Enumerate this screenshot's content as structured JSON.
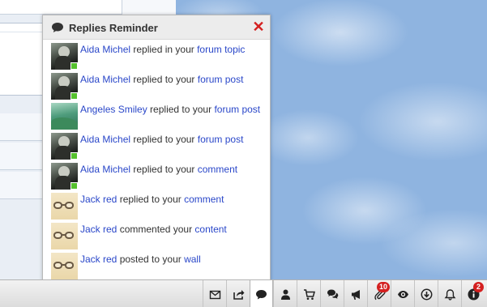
{
  "popup": {
    "title": "Replies Reminder",
    "close_label": "✕",
    "items": [
      {
        "user": "Aida Michel",
        "action": " replied in your ",
        "target": "forum topic",
        "avatar": "dark-portrait",
        "online": true
      },
      {
        "user": "Aida Michel",
        "action": " replied to your ",
        "target": "forum post",
        "avatar": "dark-portrait",
        "online": true
      },
      {
        "user": "Angeles Smiley",
        "action": " replied to your ",
        "target": "forum post",
        "avatar": "green-landscape",
        "online": false
      },
      {
        "user": "Aida Michel",
        "action": " replied to your ",
        "target": "forum post",
        "avatar": "dark-portrait",
        "online": true
      },
      {
        "user": "Aida Michel",
        "action": " replied to your ",
        "target": "comment",
        "avatar": "dark-portrait",
        "online": true
      },
      {
        "user": "Jack red",
        "action": " replied to your ",
        "target": "comment",
        "avatar": "glasses",
        "online": false
      },
      {
        "user": "Jack red",
        "action": " commented your ",
        "target": "content",
        "avatar": "glasses",
        "online": false
      },
      {
        "user": "Jack red",
        "action": " posted to your ",
        "target": "wall",
        "avatar": "glasses",
        "online": false
      }
    ]
  },
  "toolbar": {
    "buttons": [
      {
        "name": "mail-icon"
      },
      {
        "name": "share-icon"
      },
      {
        "name": "chat-icon",
        "active": true
      },
      {
        "name": "user-icon"
      },
      {
        "name": "cart-icon"
      },
      {
        "name": "comments-icon"
      },
      {
        "name": "megaphone-icon"
      },
      {
        "name": "attachment-icon",
        "badge": "10"
      },
      {
        "name": "eye-icon"
      },
      {
        "name": "download-icon"
      },
      {
        "name": "bell-icon"
      },
      {
        "name": "info-icon",
        "badge": "2"
      }
    ]
  },
  "colors": {
    "link": "#2a47c9",
    "close": "#d42020",
    "online": "#55c12e",
    "badge": "#d42020"
  }
}
